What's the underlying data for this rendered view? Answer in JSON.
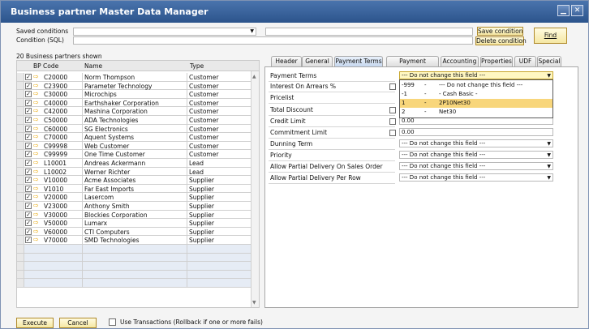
{
  "window": {
    "title": "Business partner Master Data Manager",
    "minimize_glyph": "▁",
    "close_glyph": "✕"
  },
  "filter": {
    "saved_conditions_label": "Saved conditions",
    "condition_sql_label": "Condition (SQL)",
    "saved_conditions_value": "",
    "condition_sql_value": "",
    "save_condition_button": "Save condition",
    "delete_condition_button": "Delete condition",
    "find_button": "Find"
  },
  "grid": {
    "count_label": "20 Business partners shown",
    "headers": {
      "code": "BP Code",
      "name": "Name",
      "type": "Type"
    },
    "rows": [
      {
        "code": "C20000",
        "name": "Norm Thompson",
        "type": "Customer"
      },
      {
        "code": "C23900",
        "name": "Parameter Technology",
        "type": "Customer"
      },
      {
        "code": "C30000",
        "name": "Microchips",
        "type": "Customer"
      },
      {
        "code": "C40000",
        "name": "Earthshaker Corporation",
        "type": "Customer"
      },
      {
        "code": "C42000",
        "name": "Mashina Corporation",
        "type": "Customer"
      },
      {
        "code": "C50000",
        "name": "ADA Technologies",
        "type": "Customer"
      },
      {
        "code": "C60000",
        "name": "SG Electronics",
        "type": "Customer"
      },
      {
        "code": "C70000",
        "name": "Aquent Systems",
        "type": "Customer"
      },
      {
        "code": "C99998",
        "name": "Web Customer",
        "type": "Customer"
      },
      {
        "code": "C99999",
        "name": "One Time Customer",
        "type": "Customer"
      },
      {
        "code": "L10001",
        "name": "Andreas Ackermann",
        "type": "Lead"
      },
      {
        "code": "L10002",
        "name": "Werner Richter",
        "type": "Lead"
      },
      {
        "code": "V10000",
        "name": "Acme Associates",
        "type": "Supplier"
      },
      {
        "code": "V1010",
        "name": "Far East Imports",
        "type": "Supplier"
      },
      {
        "code": "V20000",
        "name": "Lasercom",
        "type": "Supplier"
      },
      {
        "code": "V23000",
        "name": "Anthony Smith",
        "type": "Supplier"
      },
      {
        "code": "V30000",
        "name": "Blockies Corporation",
        "type": "Supplier"
      },
      {
        "code": "V50000",
        "name": "Lumarx",
        "type": "Supplier"
      },
      {
        "code": "V60000",
        "name": "CTI Computers",
        "type": "Supplier"
      },
      {
        "code": "V70000",
        "name": "SMD Technologies",
        "type": "Supplier"
      }
    ],
    "check_glyph": "✓",
    "row_arrow_glyph": "⇨",
    "scroll_up_glyph": "▲",
    "scroll_down_glyph": "▼"
  },
  "tabs": [
    "Header",
    "General",
    "Payment Terms",
    "Payment System",
    "Accounting",
    "Properties",
    "UDF",
    "Special"
  ],
  "active_tab": "Payment Terms",
  "payment_terms": {
    "fields": [
      {
        "label": "Payment Terms",
        "value": "--- Do not change this field ---"
      },
      {
        "label": "Interest On Arrears %",
        "value": ""
      },
      {
        "label": "Pricelist",
        "value": ""
      },
      {
        "label": "Total Discount",
        "value": ""
      },
      {
        "label": "Credit Limit",
        "value": "0.00"
      },
      {
        "label": "Commitment Limit",
        "value": "0.00"
      },
      {
        "label": "Dunning Term",
        "value": "--- Do not change this field ---"
      },
      {
        "label": "Priority",
        "value": "--- Do not change this field ---"
      },
      {
        "label": "Allow Partial Delivery On Sales Order",
        "value": "--- Do not change this field ---"
      },
      {
        "label": "Allow Partial Delivery Per Row",
        "value": "--- Do not change this field ---"
      }
    ],
    "dropdown_glyph": "▼",
    "dropdown_options": [
      {
        "code": "-999",
        "sep": "-",
        "label": "--- Do not change this field ---"
      },
      {
        "code": "-1",
        "sep": "-",
        "label": "- Cash Basic -"
      },
      {
        "code": "1",
        "sep": "-",
        "label": "2P10Net30"
      },
      {
        "code": "2",
        "sep": "-",
        "label": "Net30"
      }
    ],
    "selected_option": "2P10Net30"
  },
  "footer": {
    "execute_button": "Execute",
    "cancel_button": "Cancel",
    "transactions_label": "Use Transactions (Rollback if one or more fails)"
  },
  "colors": {
    "title_bar": "#2c548c",
    "button_fill": "#f5e7a3",
    "selected_option": "#f8d67b"
  }
}
